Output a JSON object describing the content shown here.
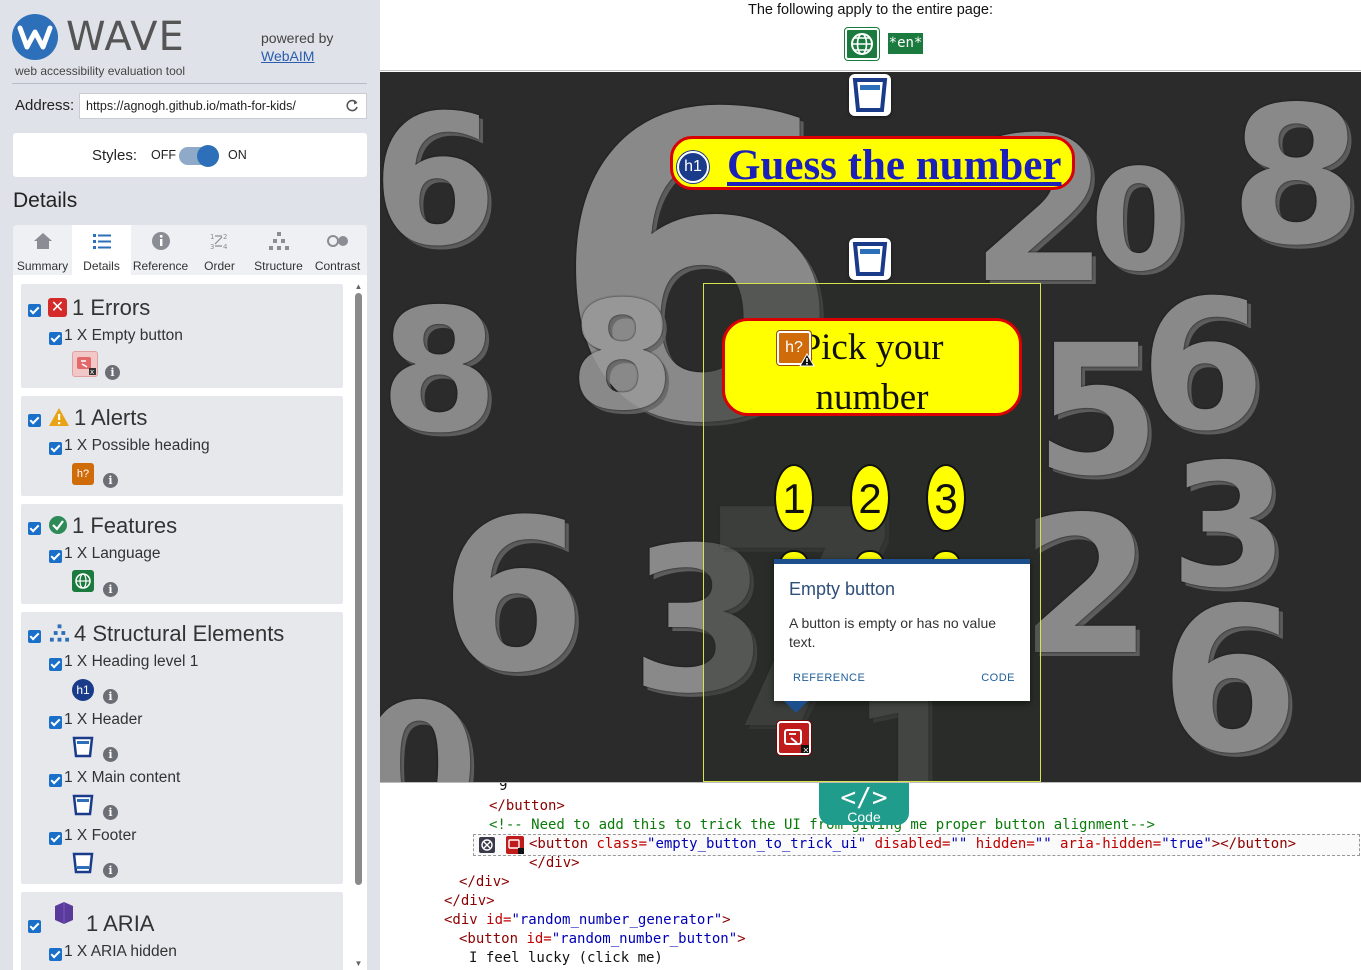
{
  "app": {
    "logo_word": "WAVE",
    "logo_sub": "web accessibility evaluation tool",
    "powered_by": "powered by",
    "powered_link": "WebAIM"
  },
  "address": {
    "label": "Address:",
    "value": "https://agnogh.github.io/math-for-kids/"
  },
  "styles": {
    "label": "Styles:",
    "off": "OFF",
    "on": "ON",
    "state": "on"
  },
  "details_title": "Details",
  "tabs": [
    {
      "label": "Summary",
      "icon": "home-icon"
    },
    {
      "label": "Details",
      "icon": "list-icon",
      "active": true
    },
    {
      "label": "Reference",
      "icon": "info-icon"
    },
    {
      "label": "Order",
      "icon": "order-icon"
    },
    {
      "label": "Structure",
      "icon": "structure-icon"
    },
    {
      "label": "Contrast",
      "icon": "contrast-icon"
    }
  ],
  "groups": {
    "errors": {
      "title": "1 Errors",
      "item": "1 X Empty button"
    },
    "alerts": {
      "title": "1 Alerts",
      "item": "1 X Possible heading",
      "badge": "h?"
    },
    "features": {
      "title": "1 Features",
      "item": "1 X Language"
    },
    "structural": {
      "title": "4 Structural Elements",
      "items": [
        {
          "label": "1 X Heading level 1",
          "badge": "h1"
        },
        {
          "label": "1 X Header"
        },
        {
          "label": "1 X Main content"
        },
        {
          "label": "1 X Footer"
        }
      ]
    },
    "aria": {
      "title": "1 ARIA",
      "item": "1 X ARIA hidden"
    }
  },
  "page": {
    "whole_page_text": "The following apply to the entire page:",
    "lang_badge": "*en*",
    "h1_badge": "h1",
    "h1_text": "Guess the number",
    "pick_badge": "h?",
    "pick_text_line1": "Pick your",
    "pick_text_line2": "number",
    "numbers": [
      "1",
      "2",
      "3"
    ],
    "bg_digits": [
      "6",
      "6",
      "2",
      "8",
      "0",
      "8",
      "8",
      "6",
      "5",
      "6",
      "3",
      "6",
      "3",
      "2",
      "6",
      "7",
      "0",
      "1"
    ]
  },
  "popup": {
    "title": "Empty button",
    "description": "A button is empty or has no value text.",
    "reference": "REFERENCE",
    "code": "CODE"
  },
  "code_tab": {
    "symbol": "</>",
    "label": "Code"
  },
  "code": {
    "line0": "9",
    "line1_tag": "</button>",
    "line2_comment": "<!-- Need to add this to trick the UI from giving me proper button alignment-->",
    "line3_open": "<button ",
    "line3_attr1": "class=",
    "line3_val1": "\"empty_button_to_trick_ui\"",
    "line3_attr2": " disabled=",
    "line3_val2": "\"\"",
    "line3_attr3": " hidden=",
    "line3_val3": "\"\"",
    "line3_attr4": " aria-hidden=",
    "line3_val4": "\"true\"",
    "line3_close": "></button>",
    "line4": "</div>",
    "line5": "</div>",
    "line6": "</div>",
    "line7_open": "<div ",
    "line7_attr": "id=",
    "line7_val": "\"random_number_generator\"",
    "line7_close": ">",
    "line8_open": "<button ",
    "line8_attr": "id=",
    "line8_val": "\"random_number_button\"",
    "line8_close": ">",
    "line9": "I feel lucky (click me)"
  },
  "colors": {
    "error": "#d42a2a",
    "alert": "#e8a317",
    "feature": "#2e8b57",
    "structure": "#2d6fb8",
    "aria": "#5a3a9a",
    "highlight_yellow": "#ffff00",
    "code_tab": "#1f9c8c"
  }
}
